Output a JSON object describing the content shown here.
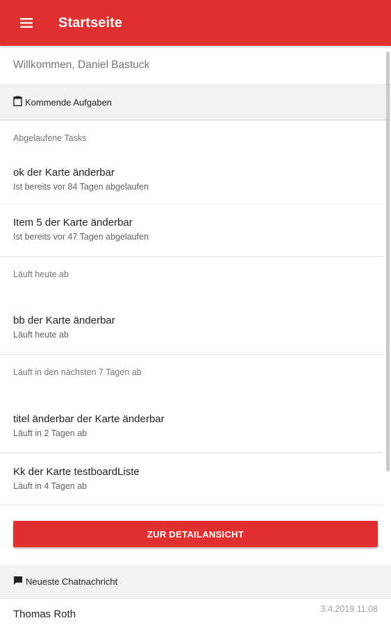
{
  "appbar": {
    "title": "Startseite",
    "menu_icon": "menu-icon",
    "color": "#e0302f"
  },
  "welcome": "Willkommen, Daniel Bastuck",
  "upcoming": {
    "header": "Kommende Aufgaben",
    "icon": "clipboard-icon",
    "groups": [
      {
        "label": "Abgelaufene Tasks",
        "tasks": [
          {
            "title": "ok der Karte änderbar",
            "subtitle": "Ist bereits vor 84 Tagen abgelaufen"
          },
          {
            "title": "Item 5 der Karte änderbar",
            "subtitle": "Ist bereits vor 47 Tagen abgelaufen"
          }
        ]
      },
      {
        "label": "Läuft heute ab",
        "tasks": [
          {
            "title": "bb der Karte änderbar",
            "subtitle": "Läuft heute ab"
          }
        ]
      },
      {
        "label": "Läuft in den nächsten 7 Tagen ab",
        "tasks": [
          {
            "title": "titel änderbar der Karte änderbar",
            "subtitle": "Läuft in 2 Tagen ab"
          },
          {
            "title": "Kk der Karte testboardListe",
            "subtitle": "Läuft in 4 Tagen ab"
          }
        ]
      }
    ],
    "button_label": "ZUR DETAILANSICHT"
  },
  "chat": {
    "header": "Neueste Chatnachricht",
    "icon": "chat-icon",
    "sender": "Thomas Roth",
    "timestamp": "3.4.2019 11:08"
  }
}
